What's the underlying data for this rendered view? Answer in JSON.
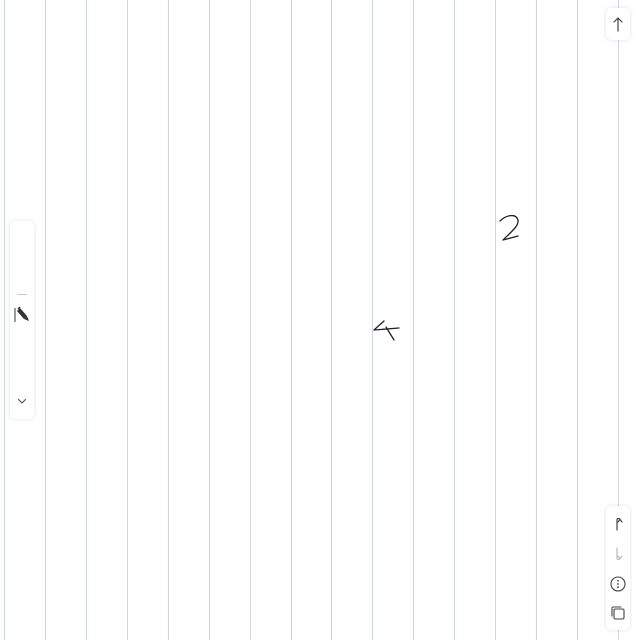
{
  "canvas": {
    "background_color": "#ffffff",
    "ruled_line_color": "#cdd6e6"
  },
  "ink": {
    "stroke_color": "#222222",
    "handwritten_marks": [
      "2",
      "4"
    ]
  },
  "left_toolbar": {
    "active_tool_icon": "pen-icon",
    "toggle_icon": "chevron-down-icon"
  },
  "top_right": {
    "icon": "arrow-up-icon"
  },
  "bottom_right_toolbar": {
    "items": [
      {
        "icon": "undo-icon",
        "enabled": true
      },
      {
        "icon": "redo-icon",
        "enabled": false
      },
      {
        "icon": "more-options-icon",
        "enabled": true
      },
      {
        "icon": "pages-icon",
        "enabled": true
      }
    ]
  }
}
